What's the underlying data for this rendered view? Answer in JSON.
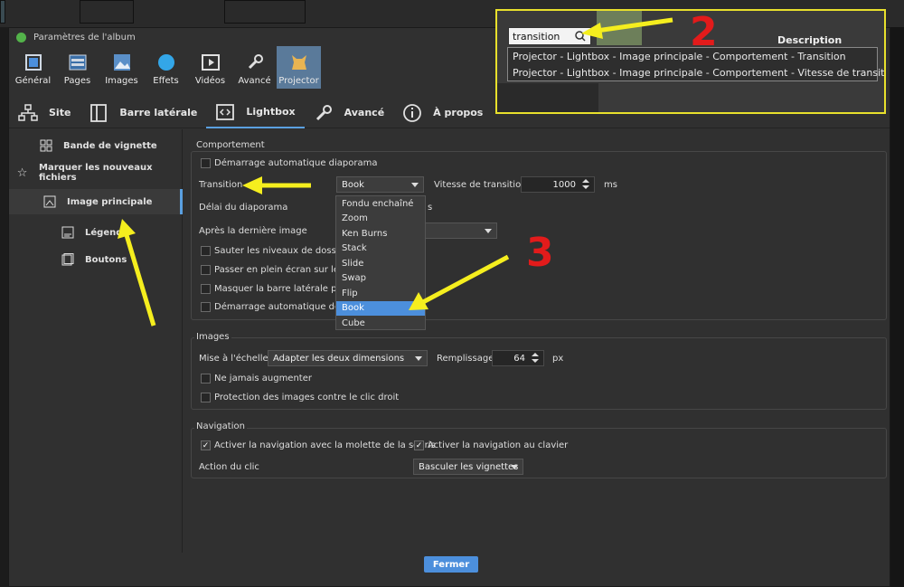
{
  "window": {
    "title": "Paramètres de l'album"
  },
  "main_tabs": [
    {
      "label": "Général",
      "icon": "general-icon"
    },
    {
      "label": "Pages",
      "icon": "pages-icon"
    },
    {
      "label": "Images",
      "icon": "images-icon"
    },
    {
      "label": "Effets",
      "icon": "effects-icon"
    },
    {
      "label": "Vidéos",
      "icon": "videos-icon"
    },
    {
      "label": "Avancé",
      "icon": "wrench-icon"
    },
    {
      "label": "Projector",
      "icon": "projector-icon",
      "active": true
    }
  ],
  "sub_tabs": [
    {
      "label": "Site",
      "icon": "sitemap-icon"
    },
    {
      "label": "Barre latérale",
      "icon": "sidebar-icon"
    },
    {
      "label": "Lightbox",
      "icon": "lightbox-icon",
      "active": true
    },
    {
      "label": "Avancé",
      "icon": "wrench-icon"
    },
    {
      "label": "À propos",
      "icon": "info-icon"
    }
  ],
  "sidebar": {
    "items": [
      {
        "label": "Bande de vignette",
        "icon": "grid-icon"
      },
      {
        "label": "Marquer les nouveaux fichiers",
        "icon": "star-icon"
      },
      {
        "label": "Image principale",
        "icon": "image-icon",
        "active": true
      },
      {
        "label": "Légende",
        "icon": "caption-icon"
      },
      {
        "label": "Boutons",
        "icon": "buttons-icon"
      }
    ]
  },
  "behaviour": {
    "title": "Comportement",
    "auto_slideshow": "Démarrage automatique diaporama",
    "transition_label": "Transition",
    "transition_value": "Book",
    "speed_label": "Vitesse de transition",
    "speed_value": "1000",
    "speed_unit": "ms",
    "delay_label": "Délai du diaporama",
    "delay_unit": "s",
    "after_last_label": "Après la dernière image",
    "skip_folders": "Sauter les niveaux de dossier",
    "fullscreen": "Passer en plein écran sur les m",
    "hide_sidebar": "Masquer la barre latérale penda",
    "auto_videos": "Démarrage automatique des vi"
  },
  "transition_options": [
    "Fondu enchaîné",
    "Zoom",
    "Ken Burns",
    "Stack",
    "Slide",
    "Swap",
    "Flip",
    "Book",
    "Cube"
  ],
  "transition_selected_index": 7,
  "images": {
    "title": "Images",
    "scale_label": "Mise à l'échelle",
    "scale_value": "Adapter les deux dimensions",
    "padding_label": "Remplissage",
    "padding_value": "64",
    "padding_unit": "px",
    "never_enlarge": "Ne jamais augmenter",
    "protect": "Protection des images contre le clic droit"
  },
  "navigation": {
    "title": "Navigation",
    "mouse_wheel": "Activer la navigation avec la molette de la souris",
    "keyboard": "Activer la navigation au clavier",
    "click_action_label": "Action du clic",
    "click_action_value": "Basculer les vignettes"
  },
  "close_label": "Fermer",
  "inset": {
    "search_value": "transition",
    "description_label": "Description",
    "suggestions": [
      "Projector - Lightbox - Image principale - Comportement - Transition",
      "Projector - Lightbox - Image principale - Comportement - Vitesse de transition"
    ]
  },
  "annotations": {
    "step2": "2",
    "step3": "3"
  },
  "colors": {
    "accent": "#4c8fdc",
    "highlight": "#e8e02c",
    "annotation_red": "#e21b1b",
    "arrow_yellow": "#f5ee1e"
  }
}
